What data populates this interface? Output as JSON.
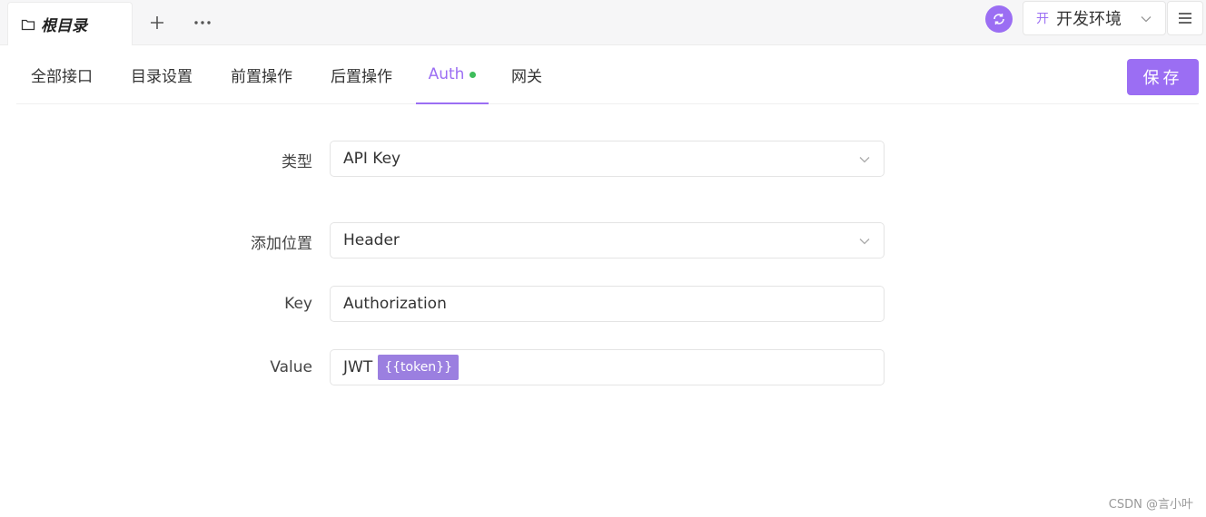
{
  "topbar": {
    "file_tab_title": "根目录",
    "icons": [
      "folder-icon",
      "plus-icon",
      "more-icon",
      "sync-icon",
      "chevron-down-icon",
      "hamburger-icon"
    ],
    "environment": {
      "badge": "开",
      "name": "开发环境"
    }
  },
  "tabs": [
    {
      "label": "全部接口",
      "active": false
    },
    {
      "label": "目录设置",
      "active": false
    },
    {
      "label": "前置操作",
      "active": false
    },
    {
      "label": "后置操作",
      "active": false
    },
    {
      "label": "Auth",
      "active": true
    },
    {
      "label": "网关",
      "active": false
    }
  ],
  "save_label": "保存",
  "form": {
    "type": {
      "label": "类型",
      "value": "API Key"
    },
    "location": {
      "label": "添加位置",
      "value": "Header"
    },
    "key": {
      "label": "Key",
      "value": "Authorization"
    },
    "value": {
      "label": "Value",
      "prefix": "JWT",
      "token": "{{token}}"
    }
  },
  "watermark": "CSDN @言小叶",
  "colors": {
    "accent": "#9b6ef3",
    "status_dot": "#3ebd5b",
    "token_bg": "#9b7fe0"
  }
}
